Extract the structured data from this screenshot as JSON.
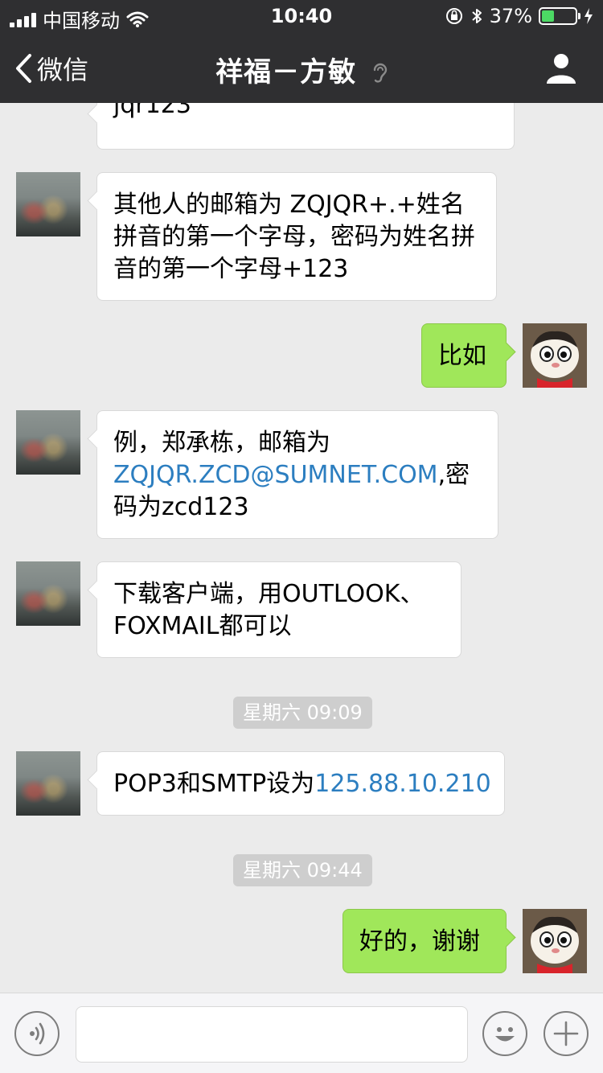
{
  "status_bar": {
    "carrier": "中国移动",
    "time": "10:40",
    "battery": "37%",
    "battery_level": 0.37
  },
  "nav": {
    "back_label": "微信",
    "title": "祥福－方敏"
  },
  "messages": [
    {
      "side": "left",
      "text": "jqr123"
    },
    {
      "side": "left",
      "text": "其他人的邮箱为 ZQJQR+.+姓名拼音的第一个字母，密码为姓名拼音的第一个字母+123"
    },
    {
      "side": "right",
      "text": "比如"
    },
    {
      "side": "left",
      "line1": "例，郑承栋，邮箱为",
      "link": "ZQJQR.ZCD@SUMNET.COM",
      "after_link": ",密",
      "line3": "码为zcd123"
    },
    {
      "side": "left",
      "line1": "下载客户端，用OUTLOOK、",
      "line2": "FOXMAIL都可以"
    },
    {
      "side": "left",
      "prefix": "POP3和SMTP设为",
      "link": "125.88.10.210"
    },
    {
      "side": "right",
      "text": "好的，谢谢"
    }
  ],
  "timestamps": [
    "星期六 09:09",
    "星期六 09:44"
  ],
  "colors": {
    "header_bg": "#2f2f31",
    "chat_bg": "#ebebeb",
    "self_bubble": "#a0e75a",
    "link": "#2c7ec0"
  },
  "icons": [
    "signal-icon",
    "wifi-icon",
    "lock-rotation-icon",
    "bluetooth-icon",
    "battery-icon",
    "charging-icon",
    "back-chevron-icon",
    "ear-icon",
    "user-profile-icon",
    "voice-icon",
    "emoji-icon",
    "plus-icon"
  ]
}
